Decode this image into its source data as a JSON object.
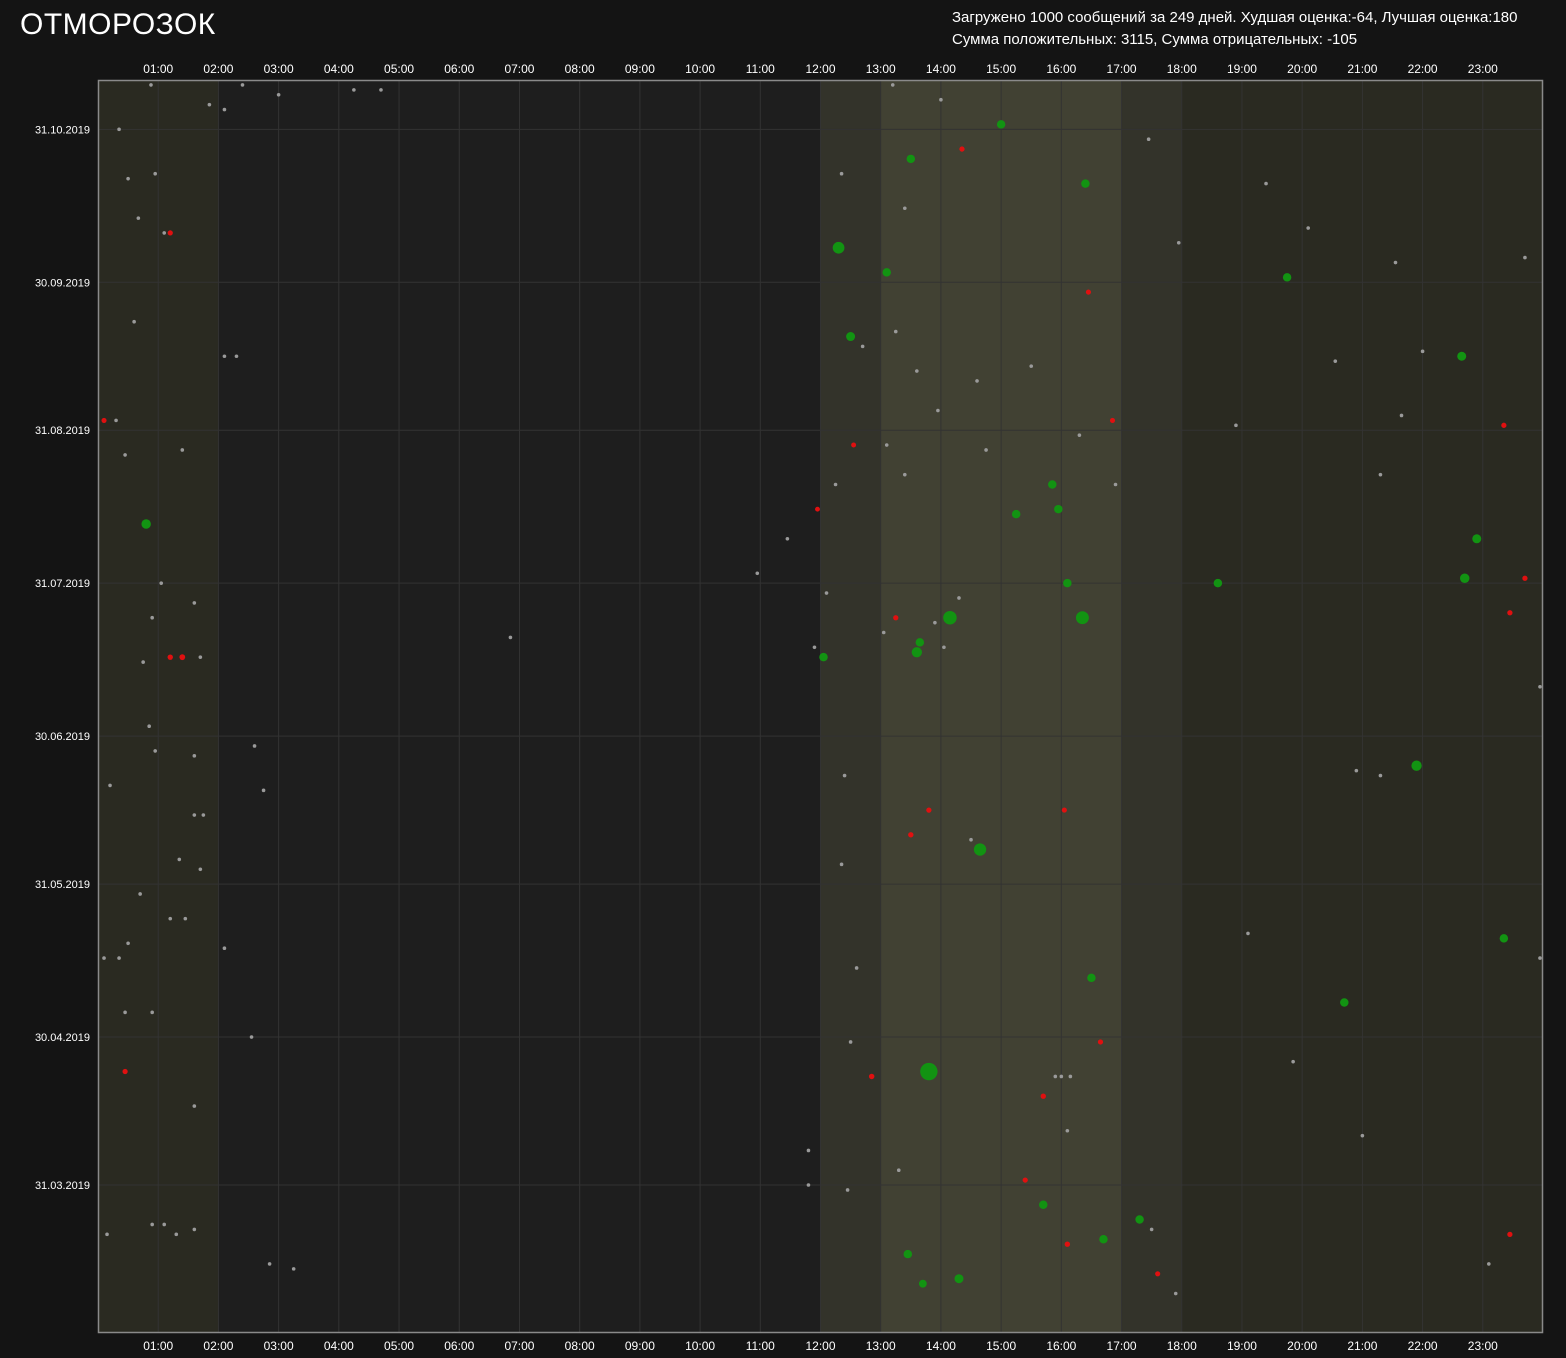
{
  "app": {
    "title": "ОТМОРОЗОК"
  },
  "stats": {
    "line1": "Загружено 1000 сообщений за 249 дней. Худшая оценка:-64, Лучшая оценка:180",
    "line2": "Сумма положительных: 3115, Сумма отрицательных: -105"
  },
  "colors": {
    "background": "#141414",
    "plot_background": "#1e1e1e",
    "grid": "#333333",
    "axis": "#8a8a8a",
    "band_light": "#2a2a21",
    "band_mid": "#33332a",
    "band_bright": "#414133",
    "neutral_point": "#9a9a9a",
    "positive_point": "#129312",
    "negative_point": "#e01010"
  },
  "chart_data": {
    "type": "scatter",
    "x_axis": {
      "unit": "hour_of_day",
      "range": [
        0,
        24
      ],
      "ticks": [
        "01:00",
        "02:00",
        "03:00",
        "04:00",
        "05:00",
        "06:00",
        "07:00",
        "08:00",
        "09:00",
        "10:00",
        "11:00",
        "12:00",
        "13:00",
        "14:00",
        "15:00",
        "16:00",
        "17:00",
        "18:00",
        "19:00",
        "20:00",
        "21:00",
        "22:00",
        "23:00"
      ],
      "position": "top and bottom"
    },
    "y_axis": {
      "unit": "date",
      "range": [
        "2019-03-01",
        "2019-11-10"
      ],
      "ticks": [
        "31.10.2019",
        "30.09.2019",
        "31.08.2019",
        "31.07.2019",
        "30.06.2019",
        "31.05.2019",
        "30.04.2019",
        "31.03.2019"
      ],
      "position": "left"
    },
    "grid": true,
    "legend": "none",
    "activity_bands": [
      {
        "from_hour": 0,
        "to_hour": 2,
        "level": "light"
      },
      {
        "from_hour": 12,
        "to_hour": 13,
        "level": "mid"
      },
      {
        "from_hour": 13,
        "to_hour": 17,
        "level": "bright"
      },
      {
        "from_hour": 17,
        "to_hour": 18,
        "level": "mid"
      },
      {
        "from_hour": 18,
        "to_hour": 24,
        "level": "light"
      }
    ],
    "points": [
      {
        "hour": 0.88,
        "date": "2019-11-09",
        "score": 0
      },
      {
        "hour": 1.85,
        "date": "2019-11-05",
        "score": 0
      },
      {
        "hour": 2.1,
        "date": "2019-11-04",
        "score": 0
      },
      {
        "hour": 2.4,
        "date": "2019-11-09",
        "score": 0
      },
      {
        "hour": 3.0,
        "date": "2019-11-07",
        "score": 0
      },
      {
        "hour": 0.35,
        "date": "2019-10-31",
        "score": 0
      },
      {
        "hour": 0.5,
        "date": "2019-10-21",
        "score": 0
      },
      {
        "hour": 0.95,
        "date": "2019-10-22",
        "score": 0
      },
      {
        "hour": 0.67,
        "date": "2019-10-13",
        "score": 0
      },
      {
        "hour": 1.1,
        "date": "2019-10-10",
        "score": 0
      },
      {
        "hour": 1.2,
        "date": "2019-10-10",
        "score": -10
      },
      {
        "hour": 0.1,
        "date": "2019-09-02",
        "score": -8
      },
      {
        "hour": 0.3,
        "date": "2019-09-02",
        "score": 0
      },
      {
        "hour": 0.45,
        "date": "2019-08-26",
        "score": 0
      },
      {
        "hour": 0.6,
        "date": "2019-09-22",
        "score": 0
      },
      {
        "hour": 1.4,
        "date": "2019-08-27",
        "score": 0
      },
      {
        "hour": 2.1,
        "date": "2019-09-15",
        "score": 0
      },
      {
        "hour": 2.3,
        "date": "2019-09-15",
        "score": 0
      },
      {
        "hour": 0.8,
        "date": "2019-08-12",
        "score": 30
      },
      {
        "hour": 1.05,
        "date": "2019-07-31",
        "score": 0
      },
      {
        "hour": 1.6,
        "date": "2019-07-27",
        "score": 0
      },
      {
        "hour": 1.2,
        "date": "2019-07-16",
        "score": -12
      },
      {
        "hour": 1.4,
        "date": "2019-07-16",
        "score": -20
      },
      {
        "hour": 1.7,
        "date": "2019-07-16",
        "score": 0
      },
      {
        "hour": 0.9,
        "date": "2019-07-24",
        "score": 0
      },
      {
        "hour": 0.75,
        "date": "2019-07-15",
        "score": 0
      },
      {
        "hour": 0.85,
        "date": "2019-07-02",
        "score": 0
      },
      {
        "hour": 0.95,
        "date": "2019-06-27",
        "score": 0
      },
      {
        "hour": 1.6,
        "date": "2019-06-26",
        "score": 0
      },
      {
        "hour": 0.2,
        "date": "2019-06-20",
        "score": 0
      },
      {
        "hour": 1.6,
        "date": "2019-06-14",
        "score": 0
      },
      {
        "hour": 1.75,
        "date": "2019-06-14",
        "score": 0
      },
      {
        "hour": 1.35,
        "date": "2019-06-05",
        "score": 0
      },
      {
        "hour": 1.7,
        "date": "2019-06-03",
        "score": 0
      },
      {
        "hour": 0.7,
        "date": "2019-05-29",
        "score": 0
      },
      {
        "hour": 1.2,
        "date": "2019-05-24",
        "score": 0
      },
      {
        "hour": 1.45,
        "date": "2019-05-24",
        "score": 0
      },
      {
        "hour": 0.1,
        "date": "2019-05-16",
        "score": 0
      },
      {
        "hour": 0.35,
        "date": "2019-05-16",
        "score": 0
      },
      {
        "hour": 0.5,
        "date": "2019-05-19",
        "score": 0
      },
      {
        "hour": 2.1,
        "date": "2019-05-18",
        "score": 0
      },
      {
        "hour": 0.45,
        "date": "2019-05-05",
        "score": 0
      },
      {
        "hour": 0.9,
        "date": "2019-05-05",
        "score": 0
      },
      {
        "hour": 0.45,
        "date": "2019-04-23",
        "score": -10
      },
      {
        "hour": 1.6,
        "date": "2019-04-16",
        "score": 0
      },
      {
        "hour": 2.55,
        "date": "2019-04-30",
        "score": 0
      },
      {
        "hour": 0.15,
        "date": "2019-03-21",
        "score": 0
      },
      {
        "hour": 0.9,
        "date": "2019-03-23",
        "score": 0
      },
      {
        "hour": 1.1,
        "date": "2019-03-23",
        "score": 0
      },
      {
        "hour": 1.3,
        "date": "2019-03-21",
        "score": 0
      },
      {
        "hour": 1.6,
        "date": "2019-03-22",
        "score": 0
      },
      {
        "hour": 2.85,
        "date": "2019-03-15",
        "score": 0
      },
      {
        "hour": 3.25,
        "date": "2019-03-14",
        "score": 0
      },
      {
        "hour": 2.6,
        "date": "2019-06-28",
        "score": 0
      },
      {
        "hour": 2.75,
        "date": "2019-06-19",
        "score": 0
      },
      {
        "hour": 6.85,
        "date": "2019-07-20",
        "score": 0
      },
      {
        "hour": 4.25,
        "date": "2019-11-08",
        "score": 0
      },
      {
        "hour": 4.7,
        "date": "2019-11-08",
        "score": 0
      },
      {
        "hour": 10.95,
        "date": "2019-08-02",
        "score": 0
      },
      {
        "hour": 11.45,
        "date": "2019-08-09",
        "score": 0
      },
      {
        "hour": 11.95,
        "date": "2019-08-15",
        "score": -5
      },
      {
        "hour": 11.9,
        "date": "2019-07-18",
        "score": 0
      },
      {
        "hour": 11.8,
        "date": "2019-04-07",
        "score": 0
      },
      {
        "hour": 11.8,
        "date": "2019-03-31",
        "score": 0
      },
      {
        "hour": 12.3,
        "date": "2019-10-07",
        "score": 60
      },
      {
        "hour": 12.35,
        "date": "2019-10-22",
        "score": 0
      },
      {
        "hour": 12.5,
        "date": "2019-09-19",
        "score": 25
      },
      {
        "hour": 12.7,
        "date": "2019-09-17",
        "score": 0
      },
      {
        "hour": 12.55,
        "date": "2019-08-28",
        "score": -6
      },
      {
        "hour": 12.25,
        "date": "2019-08-20",
        "score": 0
      },
      {
        "hour": 12.1,
        "date": "2019-07-29",
        "score": 0
      },
      {
        "hour": 12.05,
        "date": "2019-07-16",
        "score": 20
      },
      {
        "hour": 12.4,
        "date": "2019-06-22",
        "score": 0
      },
      {
        "hour": 12.35,
        "date": "2019-06-04",
        "score": 0
      },
      {
        "hour": 12.6,
        "date": "2019-05-14",
        "score": 0
      },
      {
        "hour": 12.5,
        "date": "2019-04-29",
        "score": 0
      },
      {
        "hour": 12.45,
        "date": "2019-03-30",
        "score": 0
      },
      {
        "hour": 12.85,
        "date": "2019-04-22",
        "score": -14
      },
      {
        "hour": 13.2,
        "date": "2019-11-09",
        "score": 0
      },
      {
        "hour": 13.5,
        "date": "2019-10-25",
        "score": 20
      },
      {
        "hour": 13.4,
        "date": "2019-10-15",
        "score": 0
      },
      {
        "hour": 13.1,
        "date": "2019-10-02",
        "score": 20
      },
      {
        "hour": 13.25,
        "date": "2019-09-20",
        "score": 0
      },
      {
        "hour": 13.6,
        "date": "2019-09-12",
        "score": 0
      },
      {
        "hour": 13.95,
        "date": "2019-09-04",
        "score": 0
      },
      {
        "hour": 13.1,
        "date": "2019-08-28",
        "score": 0
      },
      {
        "hour": 13.4,
        "date": "2019-08-22",
        "score": 0
      },
      {
        "hour": 13.05,
        "date": "2019-07-21",
        "score": 0
      },
      {
        "hour": 13.25,
        "date": "2019-07-24",
        "score": -10
      },
      {
        "hour": 13.6,
        "date": "2019-07-17",
        "score": 40
      },
      {
        "hour": 13.65,
        "date": "2019-07-19",
        "score": 20
      },
      {
        "hour": 13.9,
        "date": "2019-07-23",
        "score": 0
      },
      {
        "hour": 14.15,
        "date": "2019-07-24",
        "score": 90
      },
      {
        "hour": 14.05,
        "date": "2019-07-18",
        "score": 0
      },
      {
        "hour": 14.3,
        "date": "2019-07-28",
        "score": 0
      },
      {
        "hour": 13.5,
        "date": "2019-06-10",
        "score": -12
      },
      {
        "hour": 13.8,
        "date": "2019-06-15",
        "score": -10
      },
      {
        "hour": 14.65,
        "date": "2019-06-07",
        "score": 70
      },
      {
        "hour": 14.5,
        "date": "2019-06-09",
        "score": 0
      },
      {
        "hour": 13.8,
        "date": "2019-04-23",
        "score": 180
      },
      {
        "hour": 13.3,
        "date": "2019-04-03",
        "score": 0
      },
      {
        "hour": 13.45,
        "date": "2019-03-17",
        "score": 20
      },
      {
        "hour": 13.7,
        "date": "2019-03-11",
        "score": 15
      },
      {
        "hour": 14.3,
        "date": "2019-03-12",
        "score": 25
      },
      {
        "hour": 14.35,
        "date": "2019-10-27",
        "score": -10
      },
      {
        "hour": 14.0,
        "date": "2019-11-06",
        "score": 0
      },
      {
        "hour": 14.6,
        "date": "2019-09-10",
        "score": 0
      },
      {
        "hour": 14.75,
        "date": "2019-08-27",
        "score": 0
      },
      {
        "hour": 15.0,
        "date": "2019-11-01",
        "score": 20
      },
      {
        "hour": 15.25,
        "date": "2019-08-14",
        "score": 20
      },
      {
        "hour": 15.5,
        "date": "2019-09-13",
        "score": 0
      },
      {
        "hour": 15.7,
        "date": "2019-04-18",
        "score": -12
      },
      {
        "hour": 15.7,
        "date": "2019-03-27",
        "score": 20
      },
      {
        "hour": 15.4,
        "date": "2019-04-01",
        "score": -10
      },
      {
        "hour": 15.85,
        "date": "2019-08-20",
        "score": 20
      },
      {
        "hour": 15.95,
        "date": "2019-08-15",
        "score": 20
      },
      {
        "hour": 16.1,
        "date": "2019-07-31",
        "score": 20
      },
      {
        "hour": 16.05,
        "date": "2019-06-15",
        "score": -8
      },
      {
        "hour": 16.35,
        "date": "2019-07-24",
        "score": 80
      },
      {
        "hour": 16.3,
        "date": "2019-08-30",
        "score": 0
      },
      {
        "hour": 16.4,
        "date": "2019-10-20",
        "score": 20
      },
      {
        "hour": 16.45,
        "date": "2019-09-28",
        "score": -8
      },
      {
        "hour": 16.1,
        "date": "2019-04-11",
        "score": 0
      },
      {
        "hour": 15.9,
        "date": "2019-04-22",
        "score": 0
      },
      {
        "hour": 16.0,
        "date": "2019-04-22",
        "score": 0
      },
      {
        "hour": 16.15,
        "date": "2019-04-22",
        "score": 0
      },
      {
        "hour": 16.5,
        "date": "2019-05-12",
        "score": 20
      },
      {
        "hour": 16.65,
        "date": "2019-04-29",
        "score": -10
      },
      {
        "hour": 16.1,
        "date": "2019-03-19",
        "score": -12
      },
      {
        "hour": 16.7,
        "date": "2019-03-20",
        "score": 20
      },
      {
        "hour": 16.85,
        "date": "2019-09-02",
        "score": -8
      },
      {
        "hour": 16.9,
        "date": "2019-08-20",
        "score": 0
      },
      {
        "hour": 17.6,
        "date": "2019-03-13",
        "score": -8
      },
      {
        "hour": 17.5,
        "date": "2019-03-22",
        "score": 0
      },
      {
        "hour": 17.3,
        "date": "2019-03-24",
        "score": 20
      },
      {
        "hour": 17.9,
        "date": "2019-03-09",
        "score": 0
      },
      {
        "hour": 17.95,
        "date": "2019-10-08",
        "score": 0
      },
      {
        "hour": 17.45,
        "date": "2019-10-29",
        "score": 0
      },
      {
        "hour": 18.6,
        "date": "2019-07-31",
        "score": 20
      },
      {
        "hour": 18.9,
        "date": "2019-09-01",
        "score": 0
      },
      {
        "hour": 19.4,
        "date": "2019-10-20",
        "score": 0
      },
      {
        "hour": 19.75,
        "date": "2019-10-01",
        "score": 20
      },
      {
        "hour": 19.1,
        "date": "2019-05-21",
        "score": 0
      },
      {
        "hour": 19.85,
        "date": "2019-04-25",
        "score": 0
      },
      {
        "hour": 20.1,
        "date": "2019-10-11",
        "score": 0
      },
      {
        "hour": 20.55,
        "date": "2019-09-14",
        "score": 0
      },
      {
        "hour": 20.7,
        "date": "2019-05-07",
        "score": 20
      },
      {
        "hour": 20.9,
        "date": "2019-06-23",
        "score": 0
      },
      {
        "hour": 21.3,
        "date": "2019-06-22",
        "score": 0
      },
      {
        "hour": 21.0,
        "date": "2019-04-10",
        "score": 0
      },
      {
        "hour": 21.55,
        "date": "2019-10-04",
        "score": 0
      },
      {
        "hour": 21.65,
        "date": "2019-09-03",
        "score": 0
      },
      {
        "hour": 21.3,
        "date": "2019-08-22",
        "score": 0
      },
      {
        "hour": 22.0,
        "date": "2019-09-16",
        "score": 0
      },
      {
        "hour": 21.9,
        "date": "2019-06-24",
        "score": 40
      },
      {
        "hour": 22.65,
        "date": "2019-09-15",
        "score": 25
      },
      {
        "hour": 22.9,
        "date": "2019-08-09",
        "score": 25
      },
      {
        "hour": 22.7,
        "date": "2019-08-01",
        "score": 30
      },
      {
        "hour": 23.35,
        "date": "2019-09-01",
        "score": -10
      },
      {
        "hour": 23.45,
        "date": "2019-07-25",
        "score": -10
      },
      {
        "hour": 23.7,
        "date": "2019-08-01",
        "score": -10
      },
      {
        "hour": 23.35,
        "date": "2019-05-20",
        "score": 20
      },
      {
        "hour": 23.45,
        "date": "2019-03-21",
        "score": -10
      },
      {
        "hour": 23.7,
        "date": "2019-10-05",
        "score": 0
      },
      {
        "hour": 23.95,
        "date": "2019-07-10",
        "score": 0
      },
      {
        "hour": 23.95,
        "date": "2019-05-16",
        "score": 0
      },
      {
        "hour": 23.1,
        "date": "2019-03-15",
        "score": 0
      }
    ]
  }
}
